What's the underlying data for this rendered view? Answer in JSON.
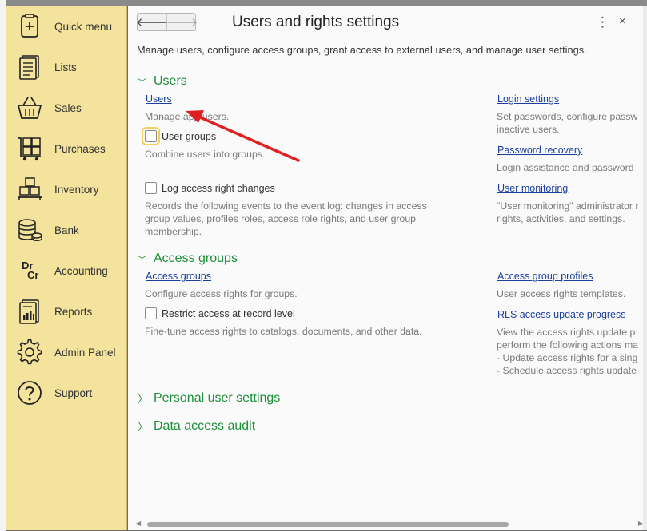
{
  "sidebar": {
    "items": [
      {
        "label": "Quick menu",
        "icon": "quick-menu-icon"
      },
      {
        "label": "Lists",
        "icon": "lists-icon"
      },
      {
        "label": "Sales",
        "icon": "sales-basket-icon"
      },
      {
        "label": "Purchases",
        "icon": "purchases-cart-icon"
      },
      {
        "label": "Inventory",
        "icon": "inventory-boxes-icon"
      },
      {
        "label": "Bank",
        "icon": "bank-coins-icon"
      },
      {
        "label": "Accounting",
        "icon": "accounting-drcr-icon"
      },
      {
        "label": "Reports",
        "icon": "reports-icon"
      },
      {
        "label": "Admin Panel",
        "icon": "gear-icon"
      },
      {
        "label": "Support",
        "icon": "help-icon"
      }
    ],
    "accounting_icon_text": {
      "dr": "Dr",
      "cr": "Cr"
    }
  },
  "header": {
    "title": "Users and rights settings",
    "back_glyph": "🡐",
    "forward_glyph": "🡒",
    "more_glyph": "⋮",
    "close_glyph": "×"
  },
  "description": "Manage users, configure access groups, grant access to external users, and manage user settings.",
  "groups": {
    "users": {
      "title": "Users",
      "left": {
        "users_link": "Users",
        "users_note": "Manage app users.",
        "user_groups_checkbox": "User groups",
        "user_groups_note": "Combine users into groups.",
        "log_changes_checkbox": "Log access right changes",
        "log_changes_note": [
          "Records the following events to the event log: changes in access",
          "group values, profiles roles, access role rights, and user group",
          "membership."
        ]
      },
      "right": {
        "login_link": "Login settings",
        "login_note": [
          "Set passwords, configure passw",
          "inactive users."
        ],
        "password_link": "Password recovery",
        "password_note": "Login assistance and password",
        "monitoring_link": "User monitoring",
        "monitoring_note": [
          "\"User monitoring\" administrator r",
          "rights, activities, and settings."
        ]
      }
    },
    "access": {
      "title": "Access groups",
      "left": {
        "access_link": "Access groups",
        "access_note": "Configure access rights for groups.",
        "restrict_checkbox": "Restrict access at record level",
        "restrict_note": "Fine-tune access rights to catalogs, documents, and other data."
      },
      "right": {
        "profiles_link": "Access group profiles",
        "profiles_note": "User access rights templates.",
        "rls_link": "RLS access update progress",
        "rls_note": [
          "View the access rights update p",
          "perform the following actions ma",
          "- Update access rights for a sing",
          "- Schedule access rights update"
        ]
      }
    },
    "personal": {
      "title": "Personal user settings"
    },
    "audit": {
      "title": "Data access audit"
    }
  },
  "chevrons": {
    "expanded": "﹀",
    "collapsed": "〉"
  },
  "colors": {
    "sidebar_bg": "#f3e39c",
    "group_title": "#1e8f3a",
    "link": "#1a3fa0",
    "annotation_arrow": "#e02020"
  }
}
